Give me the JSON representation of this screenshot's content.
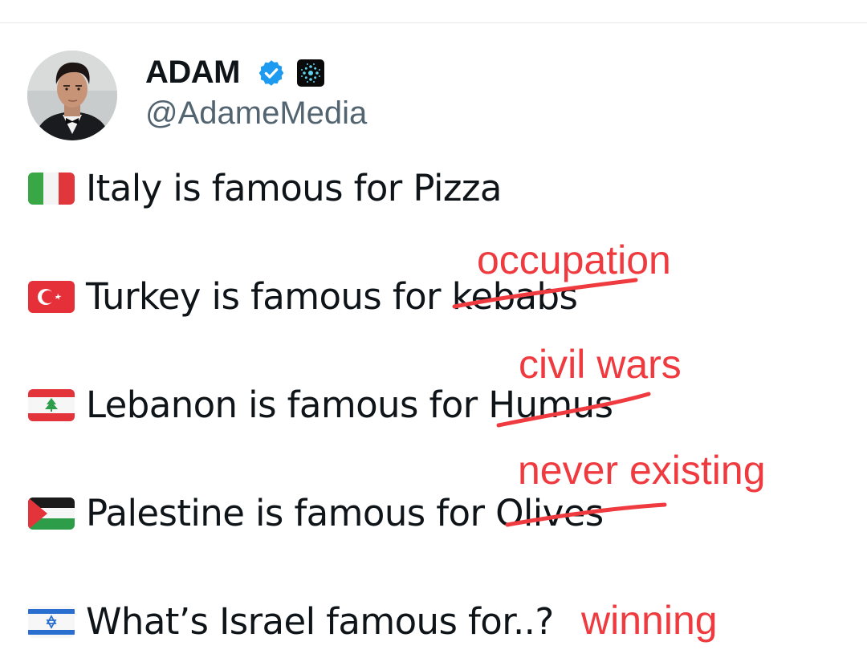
{
  "author": {
    "display_name": "ADAM",
    "handle": "@AdameMedia",
    "avatar_icon": "profile-photo",
    "verified_icon": "verified-badge-icon",
    "affiliate_icon": "affiliate-badge-icon"
  },
  "tweet": {
    "lines": [
      {
        "flag_icon": "italy-flag-icon",
        "text": "Italy is famous for Pizza"
      },
      {
        "flag_icon": "turkey-flag-icon",
        "text": "Turkey is famous for kebabs"
      },
      {
        "flag_icon": "lebanon-flag-icon",
        "text": "Lebanon is famous for Humus"
      },
      {
        "flag_icon": "palestine-flag-icon",
        "text": "Palestine is famous for Olives"
      },
      {
        "flag_icon": "israel-flag-icon",
        "text": "What’s Israel famous for..?"
      }
    ]
  },
  "annotations": {
    "turkey": "occupation",
    "lebanon": "civil wars",
    "palestine": "never existing",
    "israel": "winning"
  },
  "colors": {
    "text": "#0f1419",
    "handle": "#536471",
    "verified": "#1d9bf0",
    "annotation": "#ef3b3f"
  }
}
